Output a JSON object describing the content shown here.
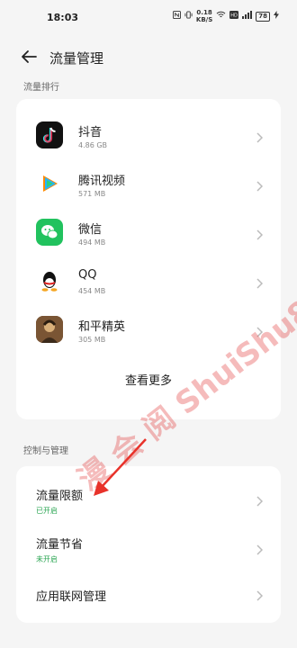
{
  "status_bar": {
    "time": "18:03",
    "net_speed_value": "0.18",
    "net_speed_unit": "KB/S",
    "battery": "78"
  },
  "header": {
    "back_icon": "back-arrow-icon",
    "title": "流量管理"
  },
  "ranking": {
    "section_label": "流量排行",
    "apps": [
      {
        "name": "抖音",
        "size": "4.86 GB",
        "icon": "douyin-icon"
      },
      {
        "name": "腾讯视频",
        "size": "571 MB",
        "icon": "tencent-video-icon"
      },
      {
        "name": "微信",
        "size": "494 MB",
        "icon": "wechat-icon"
      },
      {
        "name": "QQ",
        "size": "454 MB",
        "icon": "qq-icon"
      },
      {
        "name": "和平精英",
        "size": "305 MB",
        "icon": "game-icon"
      }
    ],
    "more_label": "查看更多"
  },
  "control": {
    "section_label": "控制与管理",
    "items": [
      {
        "title": "流量限额",
        "status": "已开启"
      },
      {
        "title": "流量节省",
        "status": "未开启"
      },
      {
        "title": "应用联网管理",
        "status": ""
      }
    ]
  },
  "watermark_text": "漫 会 阅 ShuiShu88.Com",
  "colors": {
    "accent_green": "#2aa552",
    "annotation_red": "#e8322a"
  }
}
